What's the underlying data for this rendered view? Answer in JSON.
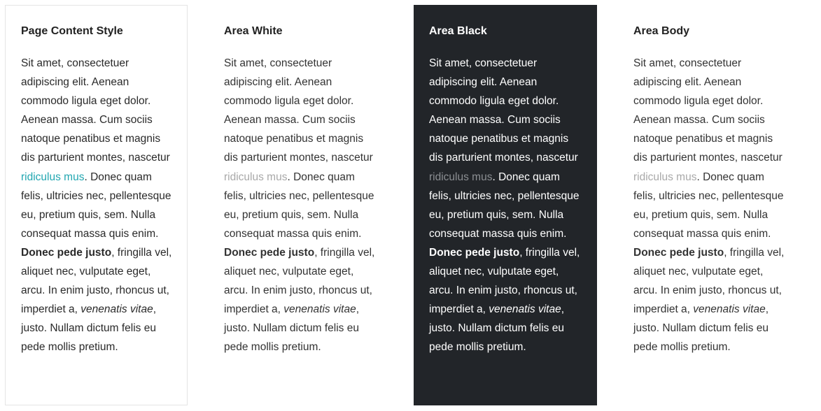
{
  "colors": {
    "black_area_bg": "#222529",
    "page_link": "#22a7b1",
    "muted_link": "#a9a9a9",
    "border": "#e4e4e4"
  },
  "columns": [
    {
      "title": "Page Content Style",
      "text_before_link": "Sit amet, consectetuer adipiscing elit. Aenean commodo ligula eget dolor. Aenean massa. Cum sociis natoque penatibus et magnis dis parturient montes, nascetur ",
      "link": "ridiculus mus",
      "text_after_link": ". Donec quam felis, ultricies nec, pellentesque eu, pretium quis, sem. Nulla consequat massa quis enim. ",
      "bold": "Donec pede justo",
      "text_after_bold": ", fringilla vel, aliquet nec, vulputate eget, arcu. In enim justo, rhoncus ut, imperdiet a, ",
      "italic": "venenatis vitae",
      "text_end": ", justo. Nullam dictum felis eu pede mollis pretium."
    },
    {
      "title": "Area White",
      "text_before_link": "Sit amet, consectetuer adipiscing elit. Aenean commodo ligula eget dolor. Aenean massa. Cum sociis natoque penatibus et magnis dis parturient montes, nascetur ",
      "link": "ridiculus mus",
      "text_after_link": ". Donec quam felis, ultricies nec, pellentesque eu, pretium quis, sem. Nulla consequat massa quis enim. ",
      "bold": "Donec pede justo",
      "text_after_bold": ", fringilla vel, aliquet nec, vulputate eget, arcu. In enim justo, rhoncus ut, imperdiet a, ",
      "italic": "venenatis vitae",
      "text_end": ", justo. Nullam dictum felis eu pede mollis pretium."
    },
    {
      "title": "Area Black",
      "text_before_link": "Sit amet, consectetuer adipiscing elit. Aenean commodo ligula eget dolor. Aenean massa. Cum sociis natoque penatibus et magnis dis parturient montes, nascetur ",
      "link": "ridiculus mus",
      "text_after_link": ". Donec quam felis, ultricies nec, pellentesque eu, pretium quis, sem. Nulla consequat massa quis enim. ",
      "bold": "Donec pede justo",
      "text_after_bold": ", fringilla vel, aliquet nec, vulputate eget, arcu. In enim justo, rhoncus ut, imperdiet a, ",
      "italic": "venenatis vitae",
      "text_end": ", justo. Nullam dictum felis eu pede mollis pretium."
    },
    {
      "title": "Area Body",
      "text_before_link": "Sit amet, consectetuer adipiscing elit. Aenean commodo ligula eget dolor. Aenean massa. Cum sociis natoque penatibus et magnis dis parturient montes, nascetur ",
      "link": "ridiculus mus",
      "text_after_link": ". Donec quam felis, ultricies nec, pellentesque eu, pretium quis, sem. Nulla consequat massa quis enim. ",
      "bold": "Donec pede justo",
      "text_after_bold": ", fringilla vel, aliquet nec, vulputate eget, arcu. In enim justo, rhoncus ut, imperdiet a, ",
      "italic": "venenatis vitae",
      "text_end": ", justo. Nullam dictum felis eu pede mollis pretium."
    }
  ]
}
